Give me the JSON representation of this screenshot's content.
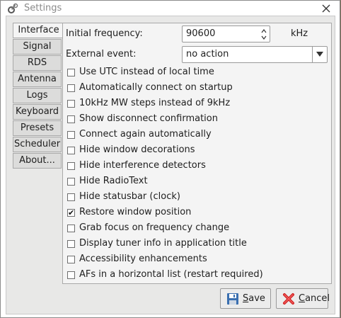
{
  "window": {
    "title": "Settings"
  },
  "tabs": [
    {
      "label": "Interface",
      "active": true
    },
    {
      "label": "Signal"
    },
    {
      "label": "RDS"
    },
    {
      "label": "Antenna"
    },
    {
      "label": "Logs"
    },
    {
      "label": "Keyboard"
    },
    {
      "label": "Presets"
    },
    {
      "label": "Scheduler"
    },
    {
      "label": "About..."
    }
  ],
  "interface": {
    "initial_frequency_label": "Initial frequency:",
    "initial_frequency_value": "90600",
    "frequency_unit": "kHz",
    "external_event_label": "External event:",
    "external_event_value": "no action",
    "options": [
      {
        "label": "Use UTC instead of local time",
        "checked": false
      },
      {
        "label": "Automatically connect on startup",
        "checked": false
      },
      {
        "label": "10kHz MW steps instead of 9kHz",
        "checked": false
      },
      {
        "label": "Show disconnect confirmation",
        "checked": false
      },
      {
        "label": "Connect again automatically",
        "checked": false
      },
      {
        "label": "Hide window decorations",
        "checked": false
      },
      {
        "label": "Hide interference detectors",
        "checked": false
      },
      {
        "label": "Hide RadioText",
        "checked": false
      },
      {
        "label": "Hide statusbar (clock)",
        "checked": false
      },
      {
        "label": "Restore window position",
        "checked": true
      },
      {
        "label": "Grab focus on frequency change",
        "checked": false
      },
      {
        "label": "Display tuner info in application title",
        "checked": false
      },
      {
        "label": "Accessibility enhancements",
        "checked": false
      },
      {
        "label": "AFs in a horizontal list (restart required)",
        "checked": false
      }
    ]
  },
  "buttons": {
    "save_mnemonic": "S",
    "save_rest": "ave",
    "cancel_mnemonic": "C",
    "cancel_rest": "ancel"
  },
  "colors": {
    "save_icon": "#3a6fb0",
    "cancel_icon": "#d02020"
  }
}
